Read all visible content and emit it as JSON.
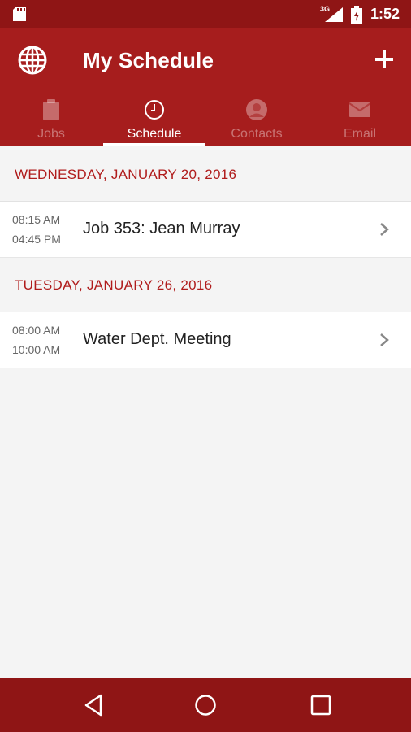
{
  "status": {
    "network_type": "3G",
    "time": "1:52"
  },
  "app_bar": {
    "title": "My Schedule",
    "logo_icon": "globe-icon",
    "action_icon": "plus-icon"
  },
  "tabs": [
    {
      "label": "Jobs",
      "icon": "clipboard-icon",
      "active": false
    },
    {
      "label": "Schedule",
      "icon": "clock-icon",
      "active": true
    },
    {
      "label": "Contacts",
      "icon": "person-icon",
      "active": false
    },
    {
      "label": "Email",
      "icon": "envelope-icon",
      "active": false
    }
  ],
  "schedule": [
    {
      "date": "WEDNESDAY, JANUARY 20, 2016",
      "events": [
        {
          "start": "08:15 AM",
          "end": "04:45 PM",
          "title": "Job 353: Jean Murray"
        }
      ]
    },
    {
      "date": "TUESDAY, JANUARY 26, 2016",
      "events": [
        {
          "start": "08:00 AM",
          "end": "10:00 AM",
          "title": "Water Dept. Meeting"
        }
      ]
    }
  ],
  "colors": {
    "primary": "#a61d1d",
    "primary_dark": "#8f1515",
    "section_text": "#b01c1c",
    "background": "#f4f4f4"
  }
}
